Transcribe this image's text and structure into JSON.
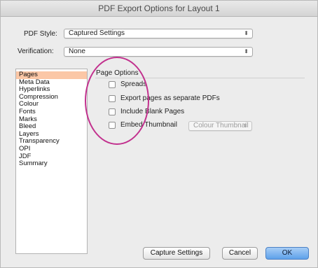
{
  "window": {
    "title": "PDF Export Options for Layout 1"
  },
  "pdf_style": {
    "label": "PDF Style:",
    "value": "Captured Settings"
  },
  "verification": {
    "label": "Verification:",
    "value": "None"
  },
  "sidebar": {
    "items": [
      {
        "label": "Pages",
        "selected": true
      },
      {
        "label": "Meta Data"
      },
      {
        "label": "Hyperlinks"
      },
      {
        "label": "Compression"
      },
      {
        "label": "Colour"
      },
      {
        "label": "Fonts"
      },
      {
        "label": "Marks"
      },
      {
        "label": "Bleed"
      },
      {
        "label": "Layers"
      },
      {
        "label": "Transparency"
      },
      {
        "label": "OPI"
      },
      {
        "label": "JDF"
      },
      {
        "label": "Summary"
      }
    ]
  },
  "page_options": {
    "title": "Page Options",
    "spreads": {
      "label": "Spreads",
      "checked": false
    },
    "export_separate": {
      "label": "Export pages as separate PDFs",
      "checked": false
    },
    "include_blank": {
      "label": "Include Blank Pages",
      "checked": false
    },
    "embed_thumbnail": {
      "label": "Embed Thumbnail",
      "checked": false,
      "mode": "Colour Thumbnail"
    }
  },
  "buttons": {
    "capture": "Capture Settings",
    "cancel": "Cancel",
    "ok": "OK"
  },
  "colors": {
    "selection": "#fbc7a6",
    "annotation": "#c2318e",
    "default_button": "#5ea1ea"
  }
}
